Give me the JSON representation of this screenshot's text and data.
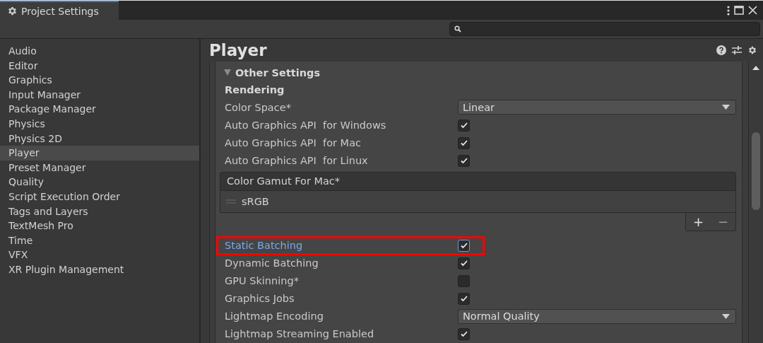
{
  "window": {
    "title": "Project Settings"
  },
  "sidebar": {
    "items": [
      {
        "label": "Audio",
        "selected": false
      },
      {
        "label": "Editor",
        "selected": false
      },
      {
        "label": "Graphics",
        "selected": false
      },
      {
        "label": "Input Manager",
        "selected": false
      },
      {
        "label": "Package Manager",
        "selected": false
      },
      {
        "label": "Physics",
        "selected": false
      },
      {
        "label": "Physics 2D",
        "selected": false
      },
      {
        "label": "Player",
        "selected": true
      },
      {
        "label": "Preset Manager",
        "selected": false
      },
      {
        "label": "Quality",
        "selected": false
      },
      {
        "label": "Script Execution Order",
        "selected": false
      },
      {
        "label": "Tags and Layers",
        "selected": false
      },
      {
        "label": "TextMesh Pro",
        "selected": false
      },
      {
        "label": "Time",
        "selected": false
      },
      {
        "label": "VFX",
        "selected": false
      },
      {
        "label": "XR Plugin Management",
        "selected": false
      }
    ]
  },
  "panel": {
    "title": "Player",
    "section": {
      "title": "Other Settings",
      "expanded": true
    },
    "rows": [
      {
        "kind": "header",
        "label": "Rendering"
      },
      {
        "kind": "dropdown",
        "label": "Color Space*",
        "value": "Linear"
      },
      {
        "kind": "toggle",
        "label": "Auto Graphics API  for Windows",
        "checked": true,
        "highlighted": false
      },
      {
        "kind": "toggle",
        "label": "Auto Graphics API  for Mac",
        "checked": true,
        "highlighted": false
      },
      {
        "kind": "toggle",
        "label": "Auto Graphics API  for Linux",
        "checked": true,
        "highlighted": false
      },
      {
        "kind": "list",
        "label": "Color Gamut For Mac*",
        "items": [
          "sRGB"
        ],
        "add": "+",
        "remove": "−"
      },
      {
        "kind": "toggle",
        "label": "Static Batching",
        "checked": true,
        "highlighted": true
      },
      {
        "kind": "toggle",
        "label": "Dynamic Batching",
        "checked": true,
        "highlighted": false
      },
      {
        "kind": "toggle",
        "label": "GPU Skinning*",
        "checked": false,
        "highlighted": false
      },
      {
        "kind": "toggle",
        "label": "Graphics Jobs",
        "checked": true,
        "highlighted": false
      },
      {
        "kind": "dropdown",
        "label": "Lightmap Encoding",
        "value": "Normal Quality"
      },
      {
        "kind": "toggle",
        "label": "Lightmap Streaming Enabled",
        "checked": true,
        "highlighted": false
      }
    ]
  }
}
